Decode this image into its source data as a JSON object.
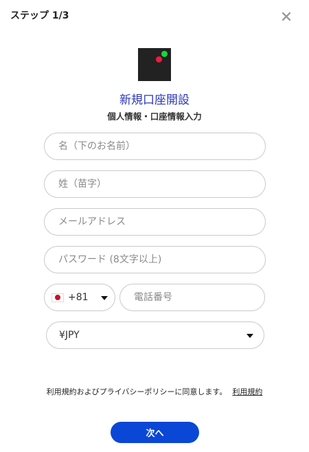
{
  "header": {
    "step_label": "ステップ 1/3",
    "close_icon": "close-icon"
  },
  "brand": {
    "logo_icon": "brand-logo",
    "colors": {
      "logo_bg": "#222222",
      "dot_green": "#19d63a",
      "dot_red": "#ee1c3e"
    }
  },
  "form": {
    "title": "新規口座開設",
    "subtitle": "個人情報・口座情報入力",
    "first_name": {
      "placeholder": "名（下のお名前）",
      "value": ""
    },
    "last_name": {
      "placeholder": "姓（苗字）",
      "value": ""
    },
    "email": {
      "placeholder": "メールアドレス",
      "value": ""
    },
    "password": {
      "placeholder": "パスワード (8文字以上)",
      "value": ""
    },
    "country_code": {
      "flag": "japan-flag-icon",
      "value": "+81"
    },
    "phone": {
      "placeholder": "電話番号",
      "value": ""
    },
    "currency": {
      "value": "¥JPY"
    }
  },
  "footer": {
    "terms_text": "利用規約およびプライバシーポリシーに同意します。",
    "terms_link": "利用規約",
    "next_button": "次へ",
    "accent_color": "#0a47d6"
  }
}
